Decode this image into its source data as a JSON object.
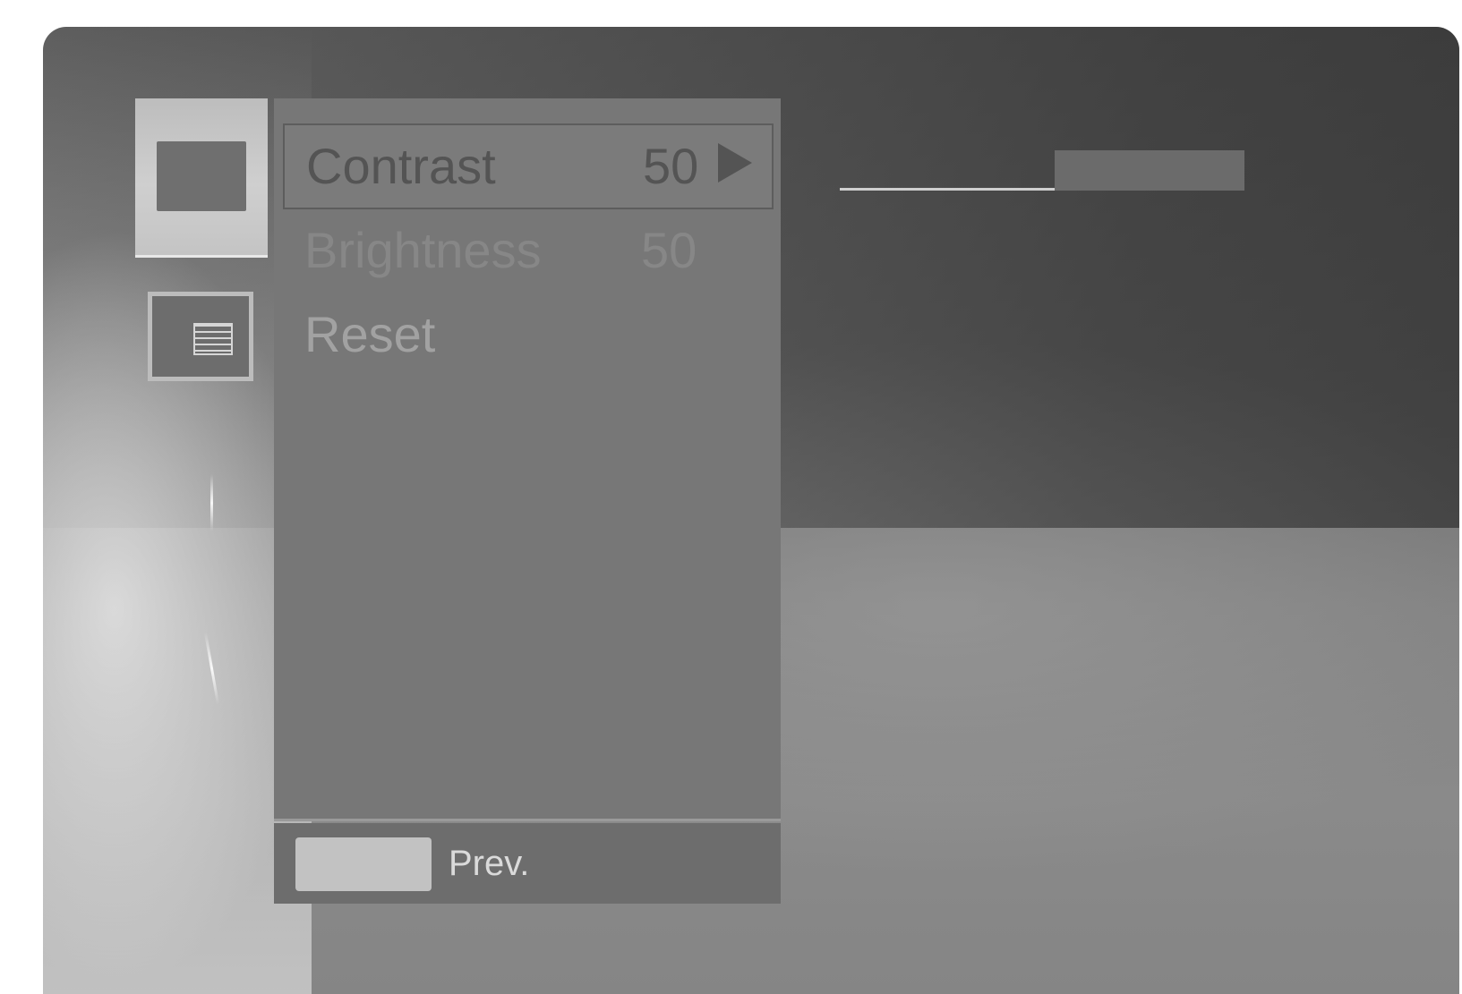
{
  "categories": [
    {
      "icon": "picture-icon",
      "active": true
    },
    {
      "icon": "option-list-icon",
      "active": false
    }
  ],
  "menu": {
    "items": [
      {
        "label": "Contrast",
        "value": "50",
        "selected": true
      },
      {
        "label": "Brightness",
        "value": "50",
        "selected": false
      },
      {
        "label": "Reset",
        "value": "",
        "selected": false
      }
    ]
  },
  "footer": {
    "prev_label": "Prev."
  },
  "adjustment": {
    "item": "Contrast",
    "value": 50,
    "range": [
      0,
      100
    ]
  }
}
